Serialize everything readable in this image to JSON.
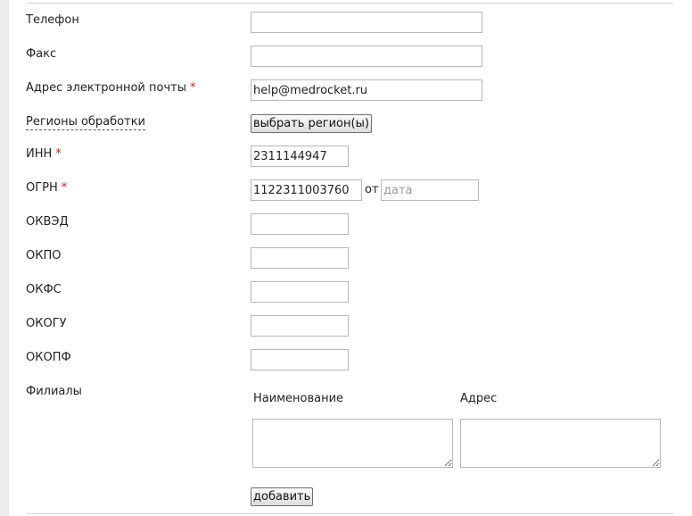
{
  "fields": {
    "phone": {
      "label": "Телефон",
      "value": ""
    },
    "fax": {
      "label": "Факс",
      "value": ""
    },
    "email": {
      "label": "Адрес электронной почты",
      "required_mark": "*",
      "value": "help@medrocket.ru"
    },
    "regions": {
      "label": "Регионы обработки",
      "button": "выбрать регион(ы)"
    },
    "inn": {
      "label": "ИНН",
      "required_mark": "*",
      "value": "2311144947"
    },
    "ogrn": {
      "label": "ОГРН",
      "required_mark": "*",
      "value": "1122311003760",
      "from_label": "от",
      "date_value": "",
      "date_placeholder": "дата"
    },
    "okved": {
      "label": "ОКВЭД",
      "value": ""
    },
    "okpo": {
      "label": "ОКПО",
      "value": ""
    },
    "okfs": {
      "label": "ОКФС",
      "value": ""
    },
    "okogu": {
      "label": "ОКОГУ",
      "value": ""
    },
    "okopf": {
      "label": "ОКОПФ",
      "value": ""
    }
  },
  "branches": {
    "label": "Филиалы",
    "columns": [
      "Наименование",
      "Адрес"
    ],
    "rows": [
      {
        "name": "",
        "address": ""
      }
    ],
    "add_button": "добавить"
  },
  "colors": {
    "required": "#d21d1d",
    "border": "#b7b7b7"
  }
}
